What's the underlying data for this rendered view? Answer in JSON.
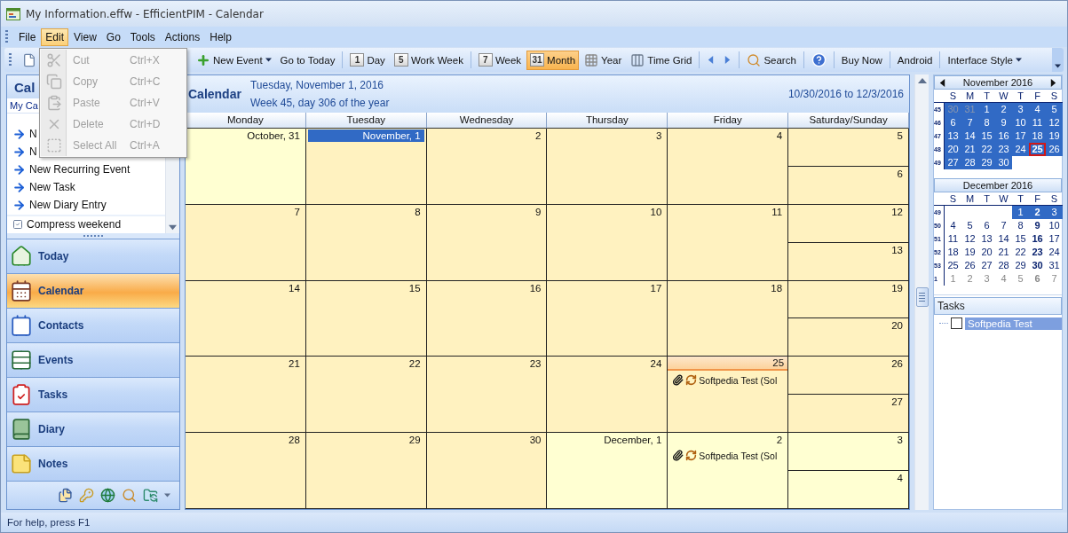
{
  "window": {
    "title": "My Information.effw - EfficientPIM - Calendar"
  },
  "menu_bar": [
    {
      "label": "File",
      "selected": false
    },
    {
      "label": "Edit",
      "selected": true
    },
    {
      "label": "View",
      "selected": false
    },
    {
      "label": "Go",
      "selected": false
    },
    {
      "label": "Tools",
      "selected": false
    },
    {
      "label": "Actions",
      "selected": false
    },
    {
      "label": "Help",
      "selected": false
    }
  ],
  "edit_menu": [
    {
      "kind": "cut",
      "label": "Cut",
      "shortcut": "Ctrl+X",
      "disabled": true
    },
    {
      "kind": "copy",
      "label": "Copy",
      "shortcut": "Ctrl+C",
      "disabled": true
    },
    {
      "kind": "paste",
      "label": "Paste",
      "shortcut": "Ctrl+V",
      "disabled": true
    },
    {
      "kind": "delete",
      "label": "Delete",
      "shortcut": "Ctrl+D",
      "disabled": true
    },
    {
      "kind": "select-all",
      "label": "Select All",
      "shortcut": "Ctrl+A",
      "disabled": true
    }
  ],
  "toolbar": [
    {
      "kind": "new-document"
    },
    {
      "kind": "new-event",
      "label": "New Event"
    },
    {
      "kind": "text",
      "label": "Go to Today"
    },
    {
      "kind": "separator"
    },
    {
      "kind": "view",
      "label": "Day",
      "badge": "1",
      "selected": false
    },
    {
      "kind": "view",
      "label": "Work Week",
      "badge": "5",
      "selected": false
    },
    {
      "kind": "separator"
    },
    {
      "kind": "view",
      "label": "Week",
      "badge": "7",
      "selected": false
    },
    {
      "kind": "view",
      "label": "Month",
      "badge": "31",
      "selected": true
    },
    {
      "kind": "year",
      "label": "Year",
      "selected": false
    },
    {
      "kind": "time-grid",
      "label": "Time Grid",
      "selected": false
    },
    {
      "kind": "separator"
    },
    {
      "kind": "previous"
    },
    {
      "kind": "next"
    },
    {
      "kind": "separator"
    },
    {
      "kind": "search",
      "label": "Search"
    },
    {
      "kind": "separator"
    },
    {
      "kind": "help"
    },
    {
      "kind": "separator"
    },
    {
      "kind": "text",
      "label": "Buy Now"
    },
    {
      "kind": "separator"
    },
    {
      "kind": "text",
      "label": "Android"
    },
    {
      "kind": "separator"
    },
    {
      "kind": "menu",
      "label": "Interface Style"
    }
  ],
  "sidebar": {
    "header": "Cal",
    "subheader": "My Ca",
    "actions": [
      "N",
      "N",
      "New Recurring Event",
      "New Task",
      "New Diary Entry"
    ],
    "option": "Compress weekend",
    "nav": [
      {
        "kind": "today",
        "label": "Today",
        "selected": false
      },
      {
        "kind": "calendar",
        "label": "Calendar",
        "selected": true
      },
      {
        "kind": "contacts",
        "label": "Contacts",
        "selected": false
      },
      {
        "kind": "events",
        "label": "Events",
        "selected": false
      },
      {
        "kind": "tasks",
        "label": "Tasks",
        "selected": false
      },
      {
        "kind": "diary",
        "label": "Diary",
        "selected": false
      },
      {
        "kind": "notes",
        "label": "Notes",
        "selected": false
      }
    ]
  },
  "calendar": {
    "title": "Calendar",
    "date": "Tuesday, November 1, 2016",
    "week_info": "Week 45, day 306 of the year",
    "range": "10/30/2016 to 12/3/2016",
    "columns": [
      "Monday",
      "Tuesday",
      "Wednesday",
      "Thursday",
      "Friday",
      "Saturday/Sunday"
    ],
    "weeks": [
      {
        "days": [
          {
            "label": "October, 31",
            "in_month": false,
            "selected": false,
            "today": false
          },
          {
            "label": "November, 1",
            "in_month": true,
            "selected": true,
            "today": false
          },
          {
            "label": "2",
            "in_month": true,
            "selected": false,
            "today": false
          },
          {
            "label": "3",
            "in_month": true,
            "selected": false,
            "today": false
          },
          {
            "label": "4",
            "in_month": true,
            "selected": false,
            "today": false
          },
          {
            "label": "5",
            "in_month": true,
            "selected": false,
            "today": false
          },
          {
            "label": "6",
            "in_month": true,
            "selected": false,
            "today": false
          }
        ]
      },
      {
        "days": [
          {
            "label": "7",
            "in_month": true,
            "selected": false,
            "today": false
          },
          {
            "label": "8",
            "in_month": true,
            "selected": false,
            "today": false
          },
          {
            "label": "9",
            "in_month": true,
            "selected": false,
            "today": false
          },
          {
            "label": "10",
            "in_month": true,
            "selected": false,
            "today": false
          },
          {
            "label": "11",
            "in_month": true,
            "selected": false,
            "today": false
          },
          {
            "label": "12",
            "in_month": true,
            "selected": false,
            "today": false
          },
          {
            "label": "13",
            "in_month": true,
            "selected": false,
            "today": false
          }
        ]
      },
      {
        "days": [
          {
            "label": "14",
            "in_month": true,
            "selected": false,
            "today": false
          },
          {
            "label": "15",
            "in_month": true,
            "selected": false,
            "today": false
          },
          {
            "label": "16",
            "in_month": true,
            "selected": false,
            "today": false
          },
          {
            "label": "17",
            "in_month": true,
            "selected": false,
            "today": false
          },
          {
            "label": "18",
            "in_month": true,
            "selected": false,
            "today": false
          },
          {
            "label": "19",
            "in_month": true,
            "selected": false,
            "today": false
          },
          {
            "label": "20",
            "in_month": true,
            "selected": false,
            "today": false
          }
        ]
      },
      {
        "days": [
          {
            "label": "21",
            "in_month": true,
            "selected": false,
            "today": false
          },
          {
            "label": "22",
            "in_month": true,
            "selected": false,
            "today": false
          },
          {
            "label": "23",
            "in_month": true,
            "selected": false,
            "today": false
          },
          {
            "label": "24",
            "in_month": true,
            "selected": false,
            "today": false
          },
          {
            "label": "25",
            "in_month": true,
            "selected": false,
            "today": true,
            "events": [
              {
                "title": "Softpedia Test (Sol",
                "attachment": true,
                "recurring": true
              }
            ]
          },
          {
            "label": "26",
            "in_month": true,
            "selected": false,
            "today": false
          },
          {
            "label": "27",
            "in_month": true,
            "selected": false,
            "today": false
          }
        ]
      },
      {
        "days": [
          {
            "label": "28",
            "in_month": true,
            "selected": false,
            "today": false
          },
          {
            "label": "29",
            "in_month": true,
            "selected": false,
            "today": false
          },
          {
            "label": "30",
            "in_month": true,
            "selected": false,
            "today": false
          },
          {
            "label": "December, 1",
            "in_month": false,
            "selected": false,
            "today": false
          },
          {
            "label": "2",
            "in_month": false,
            "selected": false,
            "today": false,
            "events": [
              {
                "title": "Softpedia Test (Sol",
                "attachment": true,
                "recurring": true
              }
            ]
          },
          {
            "label": "3",
            "in_month": false,
            "selected": false,
            "today": false
          },
          {
            "label": "4",
            "in_month": false,
            "selected": false,
            "today": false
          }
        ]
      }
    ]
  },
  "mini_calendars": [
    {
      "title": "November 2016",
      "navigation": true,
      "weekdays": [
        "S",
        "M",
        "T",
        "W",
        "T",
        "F",
        "S"
      ],
      "weeks": [
        {
          "number": "45",
          "days": [
            {
              "kind": "day",
              "label": "30",
              "muted": true,
              "selected": true,
              "bold": false,
              "today": false
            },
            {
              "kind": "day",
              "label": "31",
              "muted": true,
              "selected": true,
              "bold": false,
              "today": false
            },
            {
              "kind": "day",
              "label": "1",
              "muted": false,
              "selected": true,
              "bold": false,
              "today": false
            },
            {
              "kind": "day",
              "label": "2",
              "muted": false,
              "selected": true,
              "bold": false,
              "today": false
            },
            {
              "kind": "day",
              "label": "3",
              "muted": false,
              "selected": true,
              "bold": false,
              "today": false
            },
            {
              "kind": "day",
              "label": "4",
              "muted": false,
              "selected": true,
              "bold": false,
              "today": false
            },
            {
              "kind": "day",
              "label": "5",
              "muted": false,
              "selected": true,
              "bold": false,
              "today": false
            }
          ]
        },
        {
          "number": "46",
          "days": [
            {
              "kind": "day",
              "label": "6",
              "muted": false,
              "selected": true,
              "bold": false,
              "today": false
            },
            {
              "kind": "day",
              "label": "7",
              "muted": false,
              "selected": true,
              "bold": false,
              "today": false
            },
            {
              "kind": "day",
              "label": "8",
              "muted": false,
              "selected": true,
              "bold": false,
              "today": false
            },
            {
              "kind": "day",
              "label": "9",
              "muted": false,
              "selected": true,
              "bold": false,
              "today": false
            },
            {
              "kind": "day",
              "label": "10",
              "muted": false,
              "selected": true,
              "bold": false,
              "today": false
            },
            {
              "kind": "day",
              "label": "11",
              "muted": false,
              "selected": true,
              "bold": false,
              "today": false
            },
            {
              "kind": "day",
              "label": "12",
              "muted": false,
              "selected": true,
              "bold": false,
              "today": false
            }
          ]
        },
        {
          "number": "47",
          "days": [
            {
              "kind": "day",
              "label": "13",
              "muted": false,
              "selected": true,
              "bold": false,
              "today": false
            },
            {
              "kind": "day",
              "label": "14",
              "muted": false,
              "selected": true,
              "bold": false,
              "today": false
            },
            {
              "kind": "day",
              "label": "15",
              "muted": false,
              "selected": true,
              "bold": false,
              "today": false
            },
            {
              "kind": "day",
              "label": "16",
              "muted": false,
              "selected": true,
              "bold": false,
              "today": false
            },
            {
              "kind": "day",
              "label": "17",
              "muted": false,
              "selected": true,
              "bold": false,
              "today": false
            },
            {
              "kind": "day",
              "label": "18",
              "muted": false,
              "selected": true,
              "bold": false,
              "today": false
            },
            {
              "kind": "day",
              "label": "19",
              "muted": false,
              "selected": true,
              "bold": false,
              "today": false
            }
          ]
        },
        {
          "number": "48",
          "days": [
            {
              "kind": "day",
              "label": "20",
              "muted": false,
              "selected": true,
              "bold": false,
              "today": false
            },
            {
              "kind": "day",
              "label": "21",
              "muted": false,
              "selected": true,
              "bold": false,
              "today": false
            },
            {
              "kind": "day",
              "label": "22",
              "muted": false,
              "selected": true,
              "bold": false,
              "today": false
            },
            {
              "kind": "day",
              "label": "23",
              "muted": false,
              "selected": true,
              "bold": false,
              "today": false
            },
            {
              "kind": "day",
              "label": "24",
              "muted": false,
              "selected": true,
              "bold": false,
              "today": false
            },
            {
              "kind": "day",
              "label": "25",
              "muted": false,
              "selected": true,
              "bold": true,
              "today": true
            },
            {
              "kind": "day",
              "label": "26",
              "muted": false,
              "selected": true,
              "bold": false,
              "today": false
            }
          ]
        },
        {
          "number": "49",
          "days": [
            {
              "kind": "day",
              "label": "27",
              "muted": false,
              "selected": true,
              "bold": false,
              "today": false
            },
            {
              "kind": "day",
              "label": "28",
              "muted": false,
              "selected": true,
              "bold": false,
              "today": false
            },
            {
              "kind": "day",
              "label": "29",
              "muted": false,
              "selected": true,
              "bold": false,
              "today": false
            },
            {
              "kind": "day",
              "label": "30",
              "muted": false,
              "selected": true,
              "bold": false,
              "today": false
            },
            {
              "kind": "blank"
            },
            {
              "kind": "blank"
            },
            {
              "kind": "blank"
            }
          ]
        }
      ]
    },
    {
      "title": "December 2016",
      "navigation": false,
      "weekdays": [
        "S",
        "M",
        "T",
        "W",
        "T",
        "F",
        "S"
      ],
      "weeks": [
        {
          "number": "49",
          "days": [
            {
              "kind": "blank"
            },
            {
              "kind": "blank"
            },
            {
              "kind": "blank"
            },
            {
              "kind": "blank"
            },
            {
              "kind": "day",
              "label": "1",
              "muted": false,
              "selected": true,
              "bold": false,
              "today": false
            },
            {
              "kind": "day",
              "label": "2",
              "muted": false,
              "selected": true,
              "bold": true,
              "today": false
            },
            {
              "kind": "day",
              "label": "3",
              "muted": false,
              "selected": true,
              "bold": false,
              "today": false
            }
          ]
        },
        {
          "number": "50",
          "days": [
            {
              "kind": "day",
              "label": "4",
              "muted": false,
              "selected": false,
              "bold": false,
              "today": false
            },
            {
              "kind": "day",
              "label": "5",
              "muted": false,
              "selected": false,
              "bold": false,
              "today": false
            },
            {
              "kind": "day",
              "label": "6",
              "muted": false,
              "selected": false,
              "bold": false,
              "today": false
            },
            {
              "kind": "day",
              "label": "7",
              "muted": false,
              "selected": false,
              "bold": false,
              "today": false
            },
            {
              "kind": "day",
              "label": "8",
              "muted": false,
              "selected": false,
              "bold": false,
              "today": false
            },
            {
              "kind": "day",
              "label": "9",
              "muted": false,
              "selected": false,
              "bold": true,
              "today": false
            },
            {
              "kind": "day",
              "label": "10",
              "muted": false,
              "selected": false,
              "bold": false,
              "today": false
            }
          ]
        },
        {
          "number": "51",
          "days": [
            {
              "kind": "day",
              "label": "11",
              "muted": false,
              "selected": false,
              "bold": false,
              "today": false
            },
            {
              "kind": "day",
              "label": "12",
              "muted": false,
              "selected": false,
              "bold": false,
              "today": false
            },
            {
              "kind": "day",
              "label": "13",
              "muted": false,
              "selected": false,
              "bold": false,
              "today": false
            },
            {
              "kind": "day",
              "label": "14",
              "muted": false,
              "selected": false,
              "bold": false,
              "today": false
            },
            {
              "kind": "day",
              "label": "15",
              "muted": false,
              "selected": false,
              "bold": false,
              "today": false
            },
            {
              "kind": "day",
              "label": "16",
              "muted": false,
              "selected": false,
              "bold": true,
              "today": false
            },
            {
              "kind": "day",
              "label": "17",
              "muted": false,
              "selected": false,
              "bold": false,
              "today": false
            }
          ]
        },
        {
          "number": "52",
          "days": [
            {
              "kind": "day",
              "label": "18",
              "muted": false,
              "selected": false,
              "bold": false,
              "today": false
            },
            {
              "kind": "day",
              "label": "19",
              "muted": false,
              "selected": false,
              "bold": false,
              "today": false
            },
            {
              "kind": "day",
              "label": "20",
              "muted": false,
              "selected": false,
              "bold": false,
              "today": false
            },
            {
              "kind": "day",
              "label": "21",
              "muted": false,
              "selected": false,
              "bold": false,
              "today": false
            },
            {
              "kind": "day",
              "label": "22",
              "muted": false,
              "selected": false,
              "bold": false,
              "today": false
            },
            {
              "kind": "day",
              "label": "23",
              "muted": false,
              "selected": false,
              "bold": true,
              "today": false
            },
            {
              "kind": "day",
              "label": "24",
              "muted": false,
              "selected": false,
              "bold": false,
              "today": false
            }
          ]
        },
        {
          "number": "53",
          "days": [
            {
              "kind": "day",
              "label": "25",
              "muted": false,
              "selected": false,
              "bold": false,
              "today": false
            },
            {
              "kind": "day",
              "label": "26",
              "muted": false,
              "selected": false,
              "bold": false,
              "today": false
            },
            {
              "kind": "day",
              "label": "27",
              "muted": false,
              "selected": false,
              "bold": false,
              "today": false
            },
            {
              "kind": "day",
              "label": "28",
              "muted": false,
              "selected": false,
              "bold": false,
              "today": false
            },
            {
              "kind": "day",
              "label": "29",
              "muted": false,
              "selected": false,
              "bold": false,
              "today": false
            },
            {
              "kind": "day",
              "label": "30",
              "muted": false,
              "selected": false,
              "bold": true,
              "today": false
            },
            {
              "kind": "day",
              "label": "31",
              "muted": false,
              "selected": false,
              "bold": false,
              "today": false
            }
          ]
        },
        {
          "number": "1",
          "days": [
            {
              "kind": "day",
              "label": "1",
              "muted": true,
              "selected": false,
              "bold": false,
              "today": false
            },
            {
              "kind": "day",
              "label": "2",
              "muted": true,
              "selected": false,
              "bold": false,
              "today": false
            },
            {
              "kind": "day",
              "label": "3",
              "muted": true,
              "selected": false,
              "bold": false,
              "today": false
            },
            {
              "kind": "day",
              "label": "4",
              "muted": true,
              "selected": false,
              "bold": false,
              "today": false
            },
            {
              "kind": "day",
              "label": "5",
              "muted": true,
              "selected": false,
              "bold": false,
              "today": false
            },
            {
              "kind": "day",
              "label": "6",
              "muted": true,
              "selected": false,
              "bold": true,
              "today": false
            },
            {
              "kind": "day",
              "label": "7",
              "muted": true,
              "selected": false,
              "bold": false,
              "today": false
            }
          ]
        }
      ]
    }
  ],
  "tasks": {
    "header": "Tasks",
    "items": [
      {
        "label": "Softpedia Test",
        "checked": false,
        "selected": true
      }
    ]
  },
  "status_bar": "For help, press F1"
}
